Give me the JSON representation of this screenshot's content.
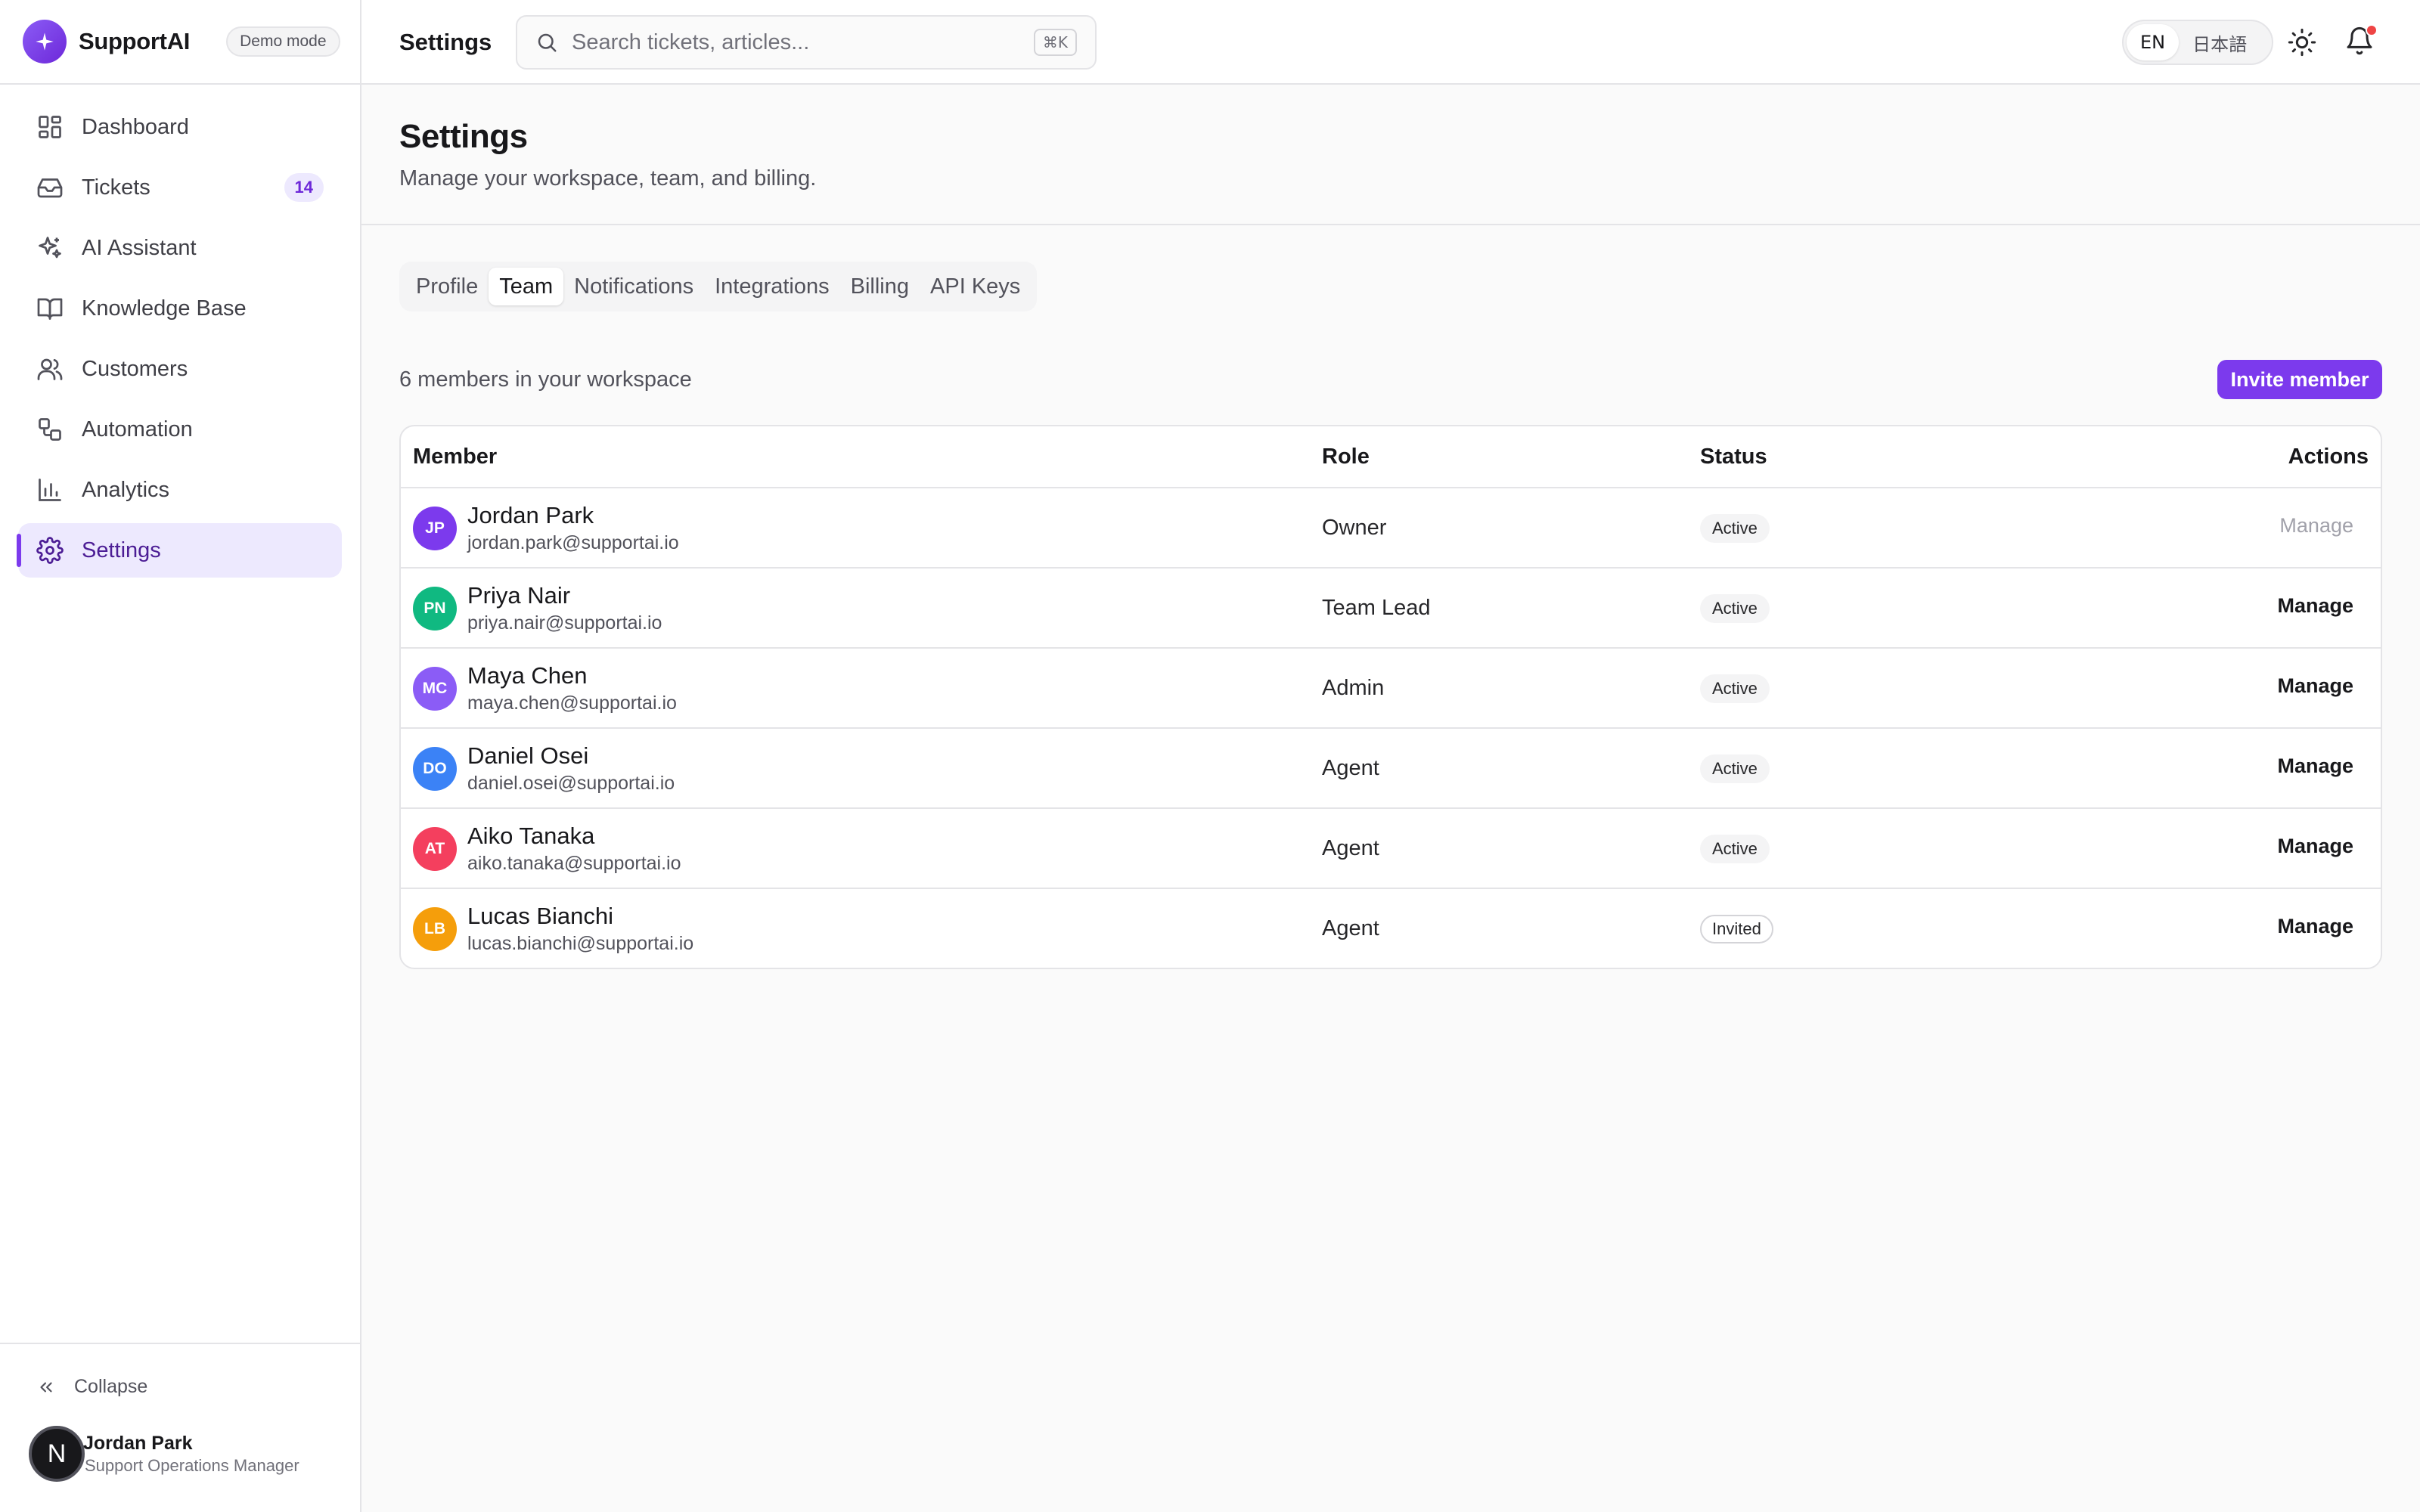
{
  "app": {
    "name": "SupportAI",
    "mode_badge": "Demo mode"
  },
  "sidebar": {
    "items": [
      {
        "label": "Dashboard",
        "icon": "dashboard-icon"
      },
      {
        "label": "Tickets",
        "icon": "inbox-icon",
        "count": "14"
      },
      {
        "label": "AI Assistant",
        "icon": "sparkles-icon"
      },
      {
        "label": "Knowledge Base",
        "icon": "book-icon"
      },
      {
        "label": "Customers",
        "icon": "users-icon"
      },
      {
        "label": "Automation",
        "icon": "workflow-icon"
      },
      {
        "label": "Analytics",
        "icon": "bar-chart-icon"
      },
      {
        "label": "Settings",
        "icon": "gear-icon",
        "active": true
      }
    ],
    "collapse_label": "Collapse",
    "user": {
      "avatar_initial": "N",
      "name": "Jordan Park",
      "role": "Support Operations Manager"
    }
  },
  "header": {
    "title": "Settings",
    "search_placeholder": "Search tickets, articles...",
    "search_shortcut": "⌘K",
    "languages": [
      "EN",
      "日本語"
    ],
    "active_language": "EN",
    "theme_icon": "sun-icon",
    "notifications_icon": "bell-icon",
    "has_unread": true
  },
  "page": {
    "title": "Settings",
    "subtitle": "Manage your workspace, team, and billing."
  },
  "tabs": [
    "Profile",
    "Team",
    "Notifications",
    "Integrations",
    "Billing",
    "API Keys"
  ],
  "active_tab": "Team",
  "team": {
    "count_text": "6 members in your workspace",
    "invite_label": "Invite member",
    "columns": [
      "Member",
      "Role",
      "Status",
      "Actions"
    ],
    "members": [
      {
        "initials": "JP",
        "name": "Jordan Park",
        "email": "jordan.park@supportai.io",
        "role": "Owner",
        "status": "Active",
        "action": "Manage",
        "color": "#7c3aed",
        "action_enabled": false
      },
      {
        "initials": "PN",
        "name": "Priya Nair",
        "email": "priya.nair@supportai.io",
        "role": "Team Lead",
        "status": "Active",
        "action": "Manage",
        "color": "#10b981",
        "action_enabled": true
      },
      {
        "initials": "MC",
        "name": "Maya Chen",
        "email": "maya.chen@supportai.io",
        "role": "Admin",
        "status": "Active",
        "action": "Manage",
        "color": "#8b5cf6",
        "action_enabled": true
      },
      {
        "initials": "DO",
        "name": "Daniel Osei",
        "email": "daniel.osei@supportai.io",
        "role": "Agent",
        "status": "Active",
        "action": "Manage",
        "color": "#3b82f6",
        "action_enabled": true
      },
      {
        "initials": "AT",
        "name": "Aiko Tanaka",
        "email": "aiko.tanaka@supportai.io",
        "role": "Agent",
        "status": "Active",
        "action": "Manage",
        "color": "#f43f5e",
        "action_enabled": true
      },
      {
        "initials": "LB",
        "name": "Lucas Bianchi",
        "email": "lucas.bianchi@supportai.io",
        "role": "Agent",
        "status": "Invited",
        "action": "Manage",
        "color": "#f59e0b",
        "action_enabled": true
      }
    ]
  },
  "colors": {
    "accent": "#7c3aed",
    "accent_soft": "#ede9fe",
    "notification_dot": "#ef4444"
  }
}
